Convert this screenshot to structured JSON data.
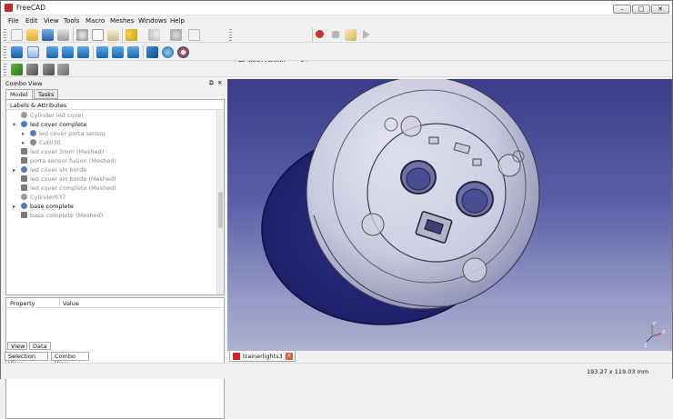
{
  "window": {
    "title": "FreeCAD",
    "minimize": "–",
    "maximize": "□",
    "close": "✕"
  },
  "menubar": [
    "File",
    "Edit",
    "View",
    "Tools",
    "Macro",
    "Meshes",
    "Windows",
    "Help"
  ],
  "toolbar": {
    "workbench": "Mesh Design",
    "workbench_arrow": "▾"
  },
  "combo": {
    "title": "Combo View",
    "float": "⧉",
    "close": "✕",
    "tabs": [
      "Model",
      "Tasks"
    ]
  },
  "tree": {
    "header": "Labels & Attributes",
    "items": [
      {
        "label": "Cylinder led cover",
        "icon": "cylinder-icon",
        "indent": 1,
        "muted": true,
        "expander": ""
      },
      {
        "label": "led cover complete",
        "icon": "shape-icon",
        "indent": 1,
        "muted": false,
        "expander": "▾"
      },
      {
        "label": "led cover porta sensor",
        "icon": "shape-icon",
        "indent": 2,
        "muted": true,
        "expander": "▸"
      },
      {
        "label": "Cut030",
        "icon": "cut-icon",
        "indent": 2,
        "muted": true,
        "expander": "▸"
      },
      {
        "label": "led cover 3mm (Meshed)",
        "icon": "mesh-icon",
        "indent": 1,
        "muted": true,
        "expander": ""
      },
      {
        "label": "porta sensor fusion (Meshed)",
        "icon": "mesh-icon",
        "indent": 1,
        "muted": true,
        "expander": ""
      },
      {
        "label": "led cover sin borde",
        "icon": "shape-icon",
        "indent": 1,
        "muted": true,
        "expander": "▸"
      },
      {
        "label": "led cover sin borde (Meshed)",
        "icon": "mesh-icon",
        "indent": 1,
        "muted": true,
        "expander": ""
      },
      {
        "label": "led cover completo (Meshed)",
        "icon": "mesh-icon",
        "indent": 1,
        "muted": true,
        "expander": ""
      },
      {
        "label": "Cylinder037",
        "icon": "cylinder-icon",
        "indent": 1,
        "muted": true,
        "expander": ""
      },
      {
        "label": "base complete",
        "icon": "shape-icon",
        "indent": 1,
        "muted": false,
        "expander": "▸"
      },
      {
        "label": "base complete (Meshed)",
        "icon": "mesh-icon",
        "indent": 1,
        "muted": true,
        "expander": ""
      }
    ]
  },
  "properties": {
    "columns": [
      "Property",
      "Value"
    ],
    "tabs": [
      "View",
      "Data"
    ]
  },
  "bottom_tabs": [
    "Selection View",
    "Combo View"
  ],
  "document_tab": {
    "label": "trainerlights3 : 1"
  },
  "status": {
    "dimensions": "193.27 x 119.03 mm"
  },
  "axes": {
    "x": "X",
    "y": "Y",
    "z": "Z"
  },
  "colors": {
    "accent": "#c62828",
    "record": "#d32f2f",
    "viewport_top": "#3a3d8c",
    "viewport_bottom": "#aeb0cf"
  }
}
